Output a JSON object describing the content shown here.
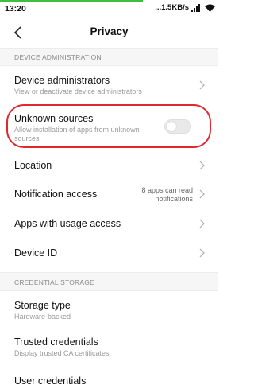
{
  "status": {
    "time": "13:20",
    "speed": "...1.5KB/s",
    "icons": [
      "signal-icon",
      "wifi-icon"
    ]
  },
  "header": {
    "title": "Privacy",
    "back_icon": "back-arrow-icon"
  },
  "sections": {
    "device_admin": {
      "label": "DEVICE ADMINISTRATION"
    },
    "credential_storage": {
      "label": "CREDENTIAL STORAGE"
    }
  },
  "rows": {
    "device_administrators": {
      "title": "Device administrators",
      "subtitle": "View or deactivate device administrators"
    },
    "unknown_sources": {
      "title": "Unknown sources",
      "subtitle_1": "Allow installation of apps from unknown",
      "subtitle_2": "sources",
      "enabled": false
    },
    "location": {
      "title": "Location"
    },
    "notification_access": {
      "title": "Notification access",
      "value_1": "8 apps can read",
      "value_2": "notifications"
    },
    "apps_usage": {
      "title": "Apps with usage access"
    },
    "device_id": {
      "title": "Device ID"
    },
    "storage_type": {
      "title": "Storage type",
      "subtitle": "Hardware-backed"
    },
    "trusted_credentials": {
      "title": "Trusted credentials",
      "subtitle": "Display trusted CA certificates"
    },
    "user_credentials": {
      "title": "User credentials"
    }
  },
  "colors": {
    "highlight": "#e0282e",
    "progress": "#3ec03e"
  }
}
